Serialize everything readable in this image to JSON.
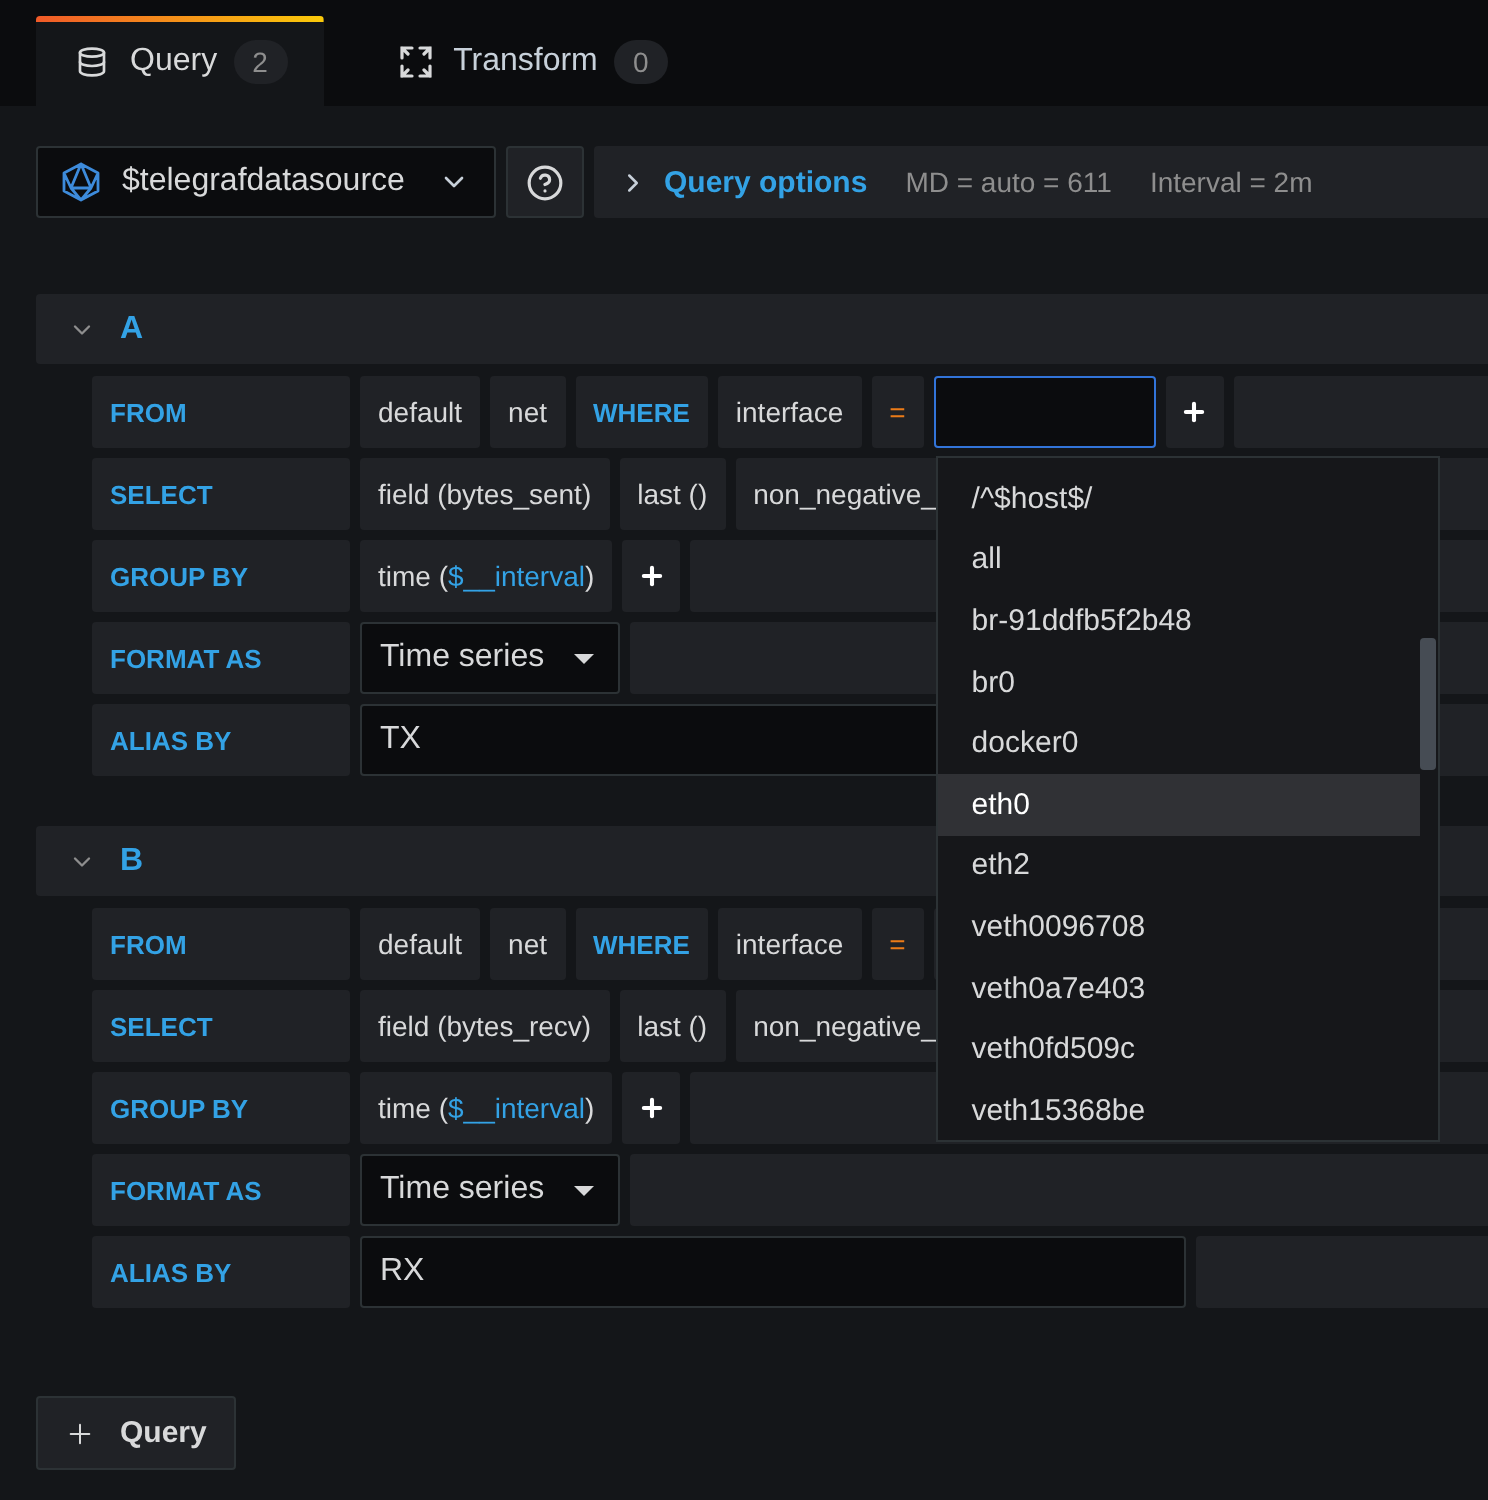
{
  "tabs": [
    {
      "label": "Query",
      "count": "2",
      "selected": true
    },
    {
      "label": "Transform",
      "count": "0",
      "selected": false
    }
  ],
  "toolbar": {
    "datasource": "$telegrafdatasource",
    "query_options": {
      "label": "Query options",
      "expanded": false,
      "details": [
        "MD = auto = 611",
        "Interval = 2m"
      ]
    }
  },
  "queries": [
    {
      "letter": "A",
      "expanded": true,
      "rows": [
        {
          "label": "FROM",
          "segments": [
            {
              "kind": "part",
              "text": "default"
            },
            {
              "kind": "part",
              "text": "net"
            },
            {
              "kind": "keyword",
              "text": "WHERE"
            },
            {
              "kind": "part",
              "text": "interface"
            },
            {
              "kind": "operator",
              "text": "="
            },
            {
              "kind": "input",
              "focused": true,
              "options": [
                {
                  "label": "/^$host$/",
                  "selected": false
                },
                {
                  "label": "all",
                  "selected": false
                },
                {
                  "label": "br-91ddfb5f2b48",
                  "selected": false
                },
                {
                  "label": "br0",
                  "selected": false
                },
                {
                  "label": "docker0",
                  "selected": false
                },
                {
                  "label": "eth0",
                  "selected": true
                },
                {
                  "label": "eth2",
                  "selected": false
                },
                {
                  "label": "veth0096708",
                  "selected": false
                },
                {
                  "label": "veth0a7e403",
                  "selected": false
                },
                {
                  "label": "veth0fd509c",
                  "selected": false
                },
                {
                  "label": "veth15368be",
                  "selected": false
                }
              ]
            },
            {
              "kind": "add"
            }
          ]
        },
        {
          "label": "SELECT",
          "segments": [
            {
              "kind": "part",
              "text": "field (bytes_sent)"
            },
            {
              "kind": "part",
              "text": "last ()"
            },
            {
              "kind": "part",
              "text": "non_negative_"
            }
          ]
        },
        {
          "label": "GROUP BY",
          "segments": [
            {
              "kind": "expression",
              "parts": [
                {
                  "kind": "plain",
                  "text": "time ("
                },
                {
                  "kind": "variable",
                  "text": "$__interval"
                },
                {
                  "kind": "plain",
                  "text": ")"
                }
              ]
            },
            {
              "kind": "add"
            }
          ]
        },
        {
          "label": "FORMAT AS",
          "segments": [
            {
              "kind": "select",
              "value": "Time series"
            }
          ]
        },
        {
          "label": "ALIAS BY",
          "segments": [
            {
              "kind": "text_input",
              "value": "TX"
            }
          ]
        }
      ]
    },
    {
      "letter": "B",
      "expanded": true,
      "rows": [
        {
          "label": "FROM",
          "segments": [
            {
              "kind": "part",
              "text": "default"
            },
            {
              "kind": "part",
              "text": "net"
            },
            {
              "kind": "keyword",
              "text": "WHERE"
            },
            {
              "kind": "part",
              "text": "interface"
            },
            {
              "kind": "operator",
              "text": "="
            }
          ]
        },
        {
          "label": "SELECT",
          "segments": [
            {
              "kind": "part",
              "text": "field (bytes_recv)"
            },
            {
              "kind": "part",
              "text": "last ()"
            },
            {
              "kind": "part",
              "text": "non_negative_"
            }
          ]
        },
        {
          "label": "GROUP BY",
          "segments": [
            {
              "kind": "expression",
              "parts": [
                {
                  "kind": "plain",
                  "text": "time ("
                },
                {
                  "kind": "variable",
                  "text": "$__interval"
                },
                {
                  "kind": "plain",
                  "text": ")"
                }
              ]
            },
            {
              "kind": "add"
            }
          ]
        },
        {
          "label": "FORMAT AS",
          "segments": [
            {
              "kind": "select",
              "value": "Time series"
            }
          ]
        },
        {
          "label": "ALIAS BY",
          "segments": [
            {
              "kind": "text_input",
              "value": "RX"
            }
          ]
        }
      ]
    }
  ],
  "add_query": "Query"
}
